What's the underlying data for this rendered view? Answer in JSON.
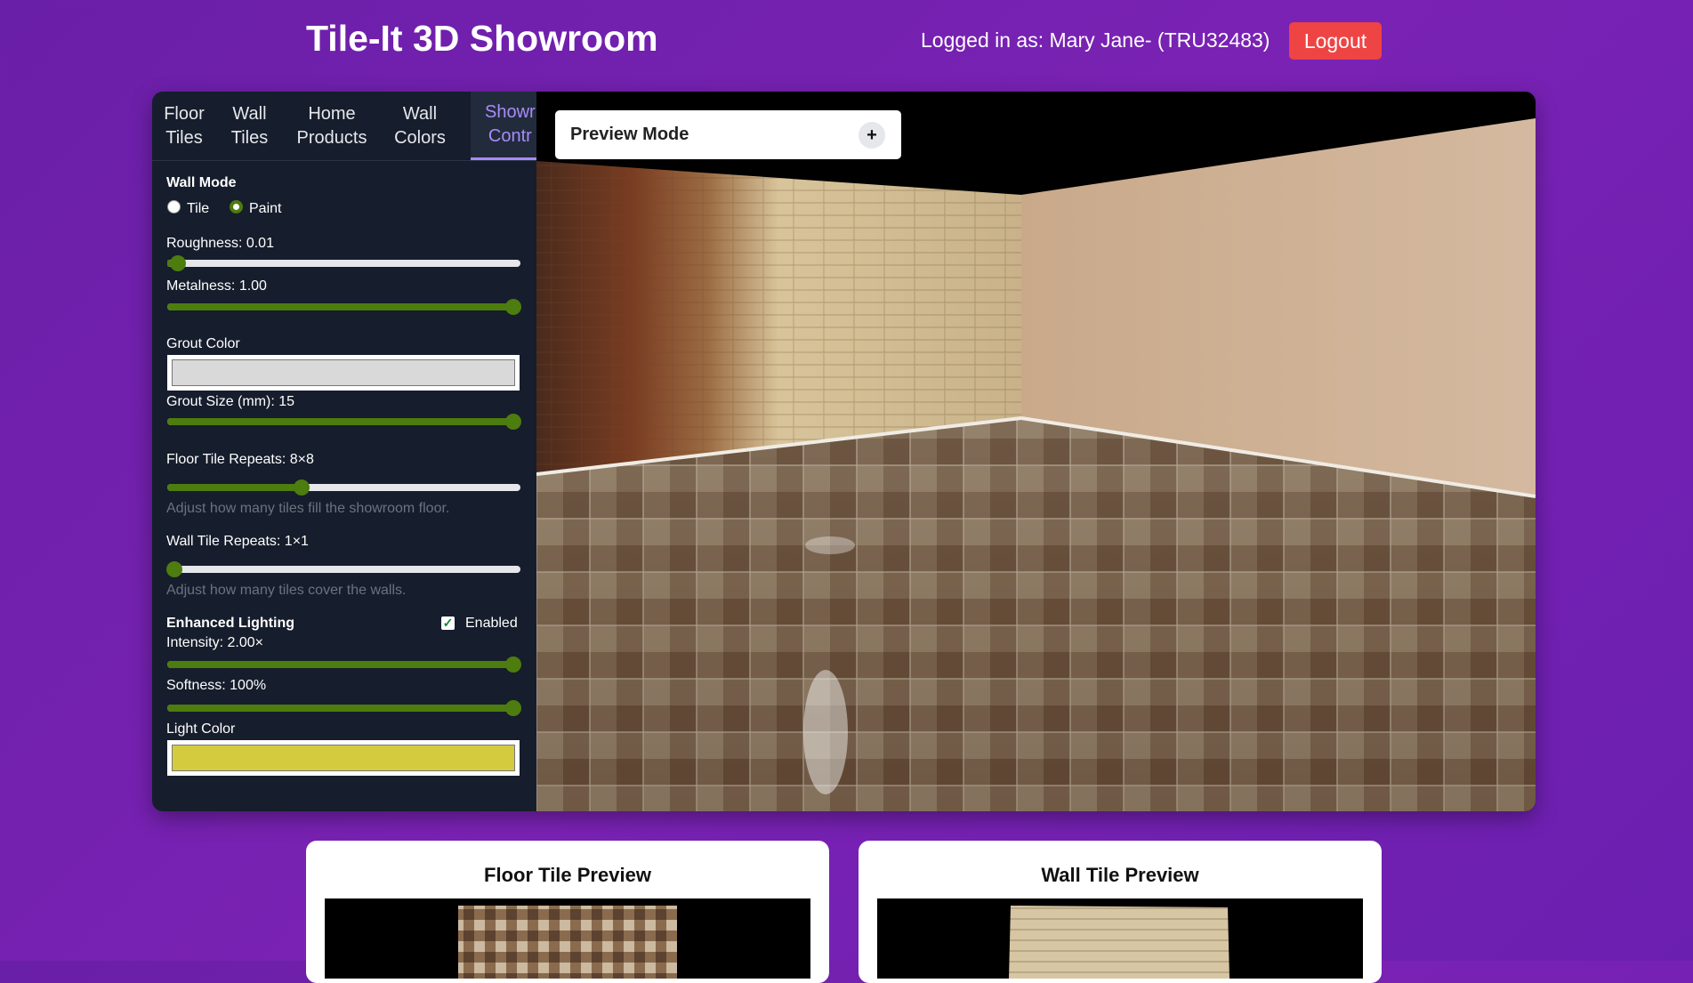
{
  "header": {
    "title": "Tile-It 3D Showroom",
    "user_label": "Logged in as: Mary Jane- (TRU32483)",
    "logout_label": "Logout"
  },
  "tabs": [
    {
      "label": "Floor\nTiles"
    },
    {
      "label": "Wall\nTiles"
    },
    {
      "label": "Home\nProducts"
    },
    {
      "label": "Wall\nColors"
    },
    {
      "label": "Showr\nContr"
    }
  ],
  "controls": {
    "wall_mode": {
      "label": "Wall Mode",
      "options": [
        "Tile",
        "Paint"
      ],
      "selected": "Paint"
    },
    "roughness": {
      "label": "Roughness: 0.01",
      "value": 0.01
    },
    "metalness": {
      "label": "Metalness: 1.00",
      "value": 1.0
    },
    "grout_color": {
      "label": "Grout Color",
      "color": "#d9d9d9"
    },
    "grout_size": {
      "label": "Grout Size (mm): 15",
      "value": 1.0
    },
    "floor_tile_repeats": {
      "label": "Floor Tile Repeats: 8×8",
      "value": 0.38,
      "hint": "Adjust how many tiles fill the showroom floor."
    },
    "wall_tile_repeats": {
      "label": "Wall Tile Repeats: 1×1",
      "value": 0.0,
      "hint": "Adjust how many tiles cover the walls."
    },
    "lighting": {
      "label": "Enhanced Lighting",
      "enabled_label": "Enabled",
      "enabled": true
    },
    "intensity": {
      "label": "Intensity: 2.00×",
      "value": 1.0
    },
    "softness": {
      "label": "Softness: 100%",
      "value": 1.0
    },
    "light_color": {
      "label": "Light Color",
      "color": "#d4cb3f"
    }
  },
  "viewport": {
    "preview_mode_label": "Preview Mode",
    "plus_label": "+"
  },
  "previews": {
    "floor_title": "Floor Tile Preview",
    "wall_title": "Wall Tile Preview"
  }
}
